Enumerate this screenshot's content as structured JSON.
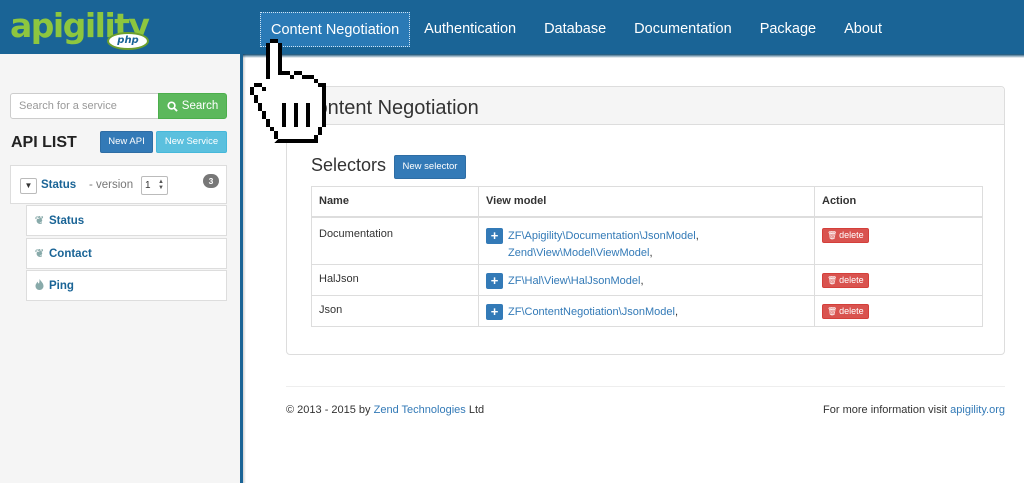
{
  "brand": {
    "name": "apigility",
    "sub": "php",
    "colors": {
      "navbar": "#1a6496",
      "logo": "#8dc63f",
      "primary": "#337ab7",
      "success": "#5cb85c",
      "info": "#5bc0de",
      "danger": "#d9534f"
    }
  },
  "nav": {
    "items": [
      {
        "label": "Content Negotiation",
        "active": true
      },
      {
        "label": "Authentication"
      },
      {
        "label": "Database"
      },
      {
        "label": "Documentation"
      },
      {
        "label": "Package"
      },
      {
        "label": "About"
      }
    ]
  },
  "sidebar": {
    "search": {
      "placeholder": "Search for a service",
      "button_label": "Search",
      "icon": "search-icon"
    },
    "api_list_title": "API LIST",
    "new_api_label": "New API",
    "new_service_label": "New Service",
    "api": {
      "name": "Status",
      "version_label": "- version",
      "version_value": "1",
      "service_count": "3"
    },
    "services": [
      {
        "name": "Status",
        "icon": "leaf-icon"
      },
      {
        "name": "Contact",
        "icon": "leaf-icon"
      },
      {
        "name": "Ping",
        "icon": "fire-icon"
      }
    ]
  },
  "main": {
    "title": "Content Negotiation",
    "selectors_title": "Selectors",
    "new_selector_label": "New selector",
    "table": {
      "headers": {
        "name": "Name",
        "view_model": "View model",
        "action": "Action"
      },
      "rows": [
        {
          "name": "Documentation",
          "models": [
            "ZF\\Apigility\\Documentation\\JsonModel",
            "Zend\\View\\Model\\ViewModel"
          ]
        },
        {
          "name": "HalJson",
          "models": [
            "ZF\\Hal\\View\\HalJsonModel"
          ]
        },
        {
          "name": "Json",
          "models": [
            "ZF\\ContentNegotiation\\JsonModel"
          ]
        }
      ],
      "delete_label": "delete"
    }
  },
  "footer": {
    "copyright_prefix": "© 2013 - 2015 by",
    "copyright_link": "Zend Technologies",
    "copyright_suffix": "Ltd",
    "info_prefix": "For more information visit",
    "info_link": "apigility.org"
  }
}
